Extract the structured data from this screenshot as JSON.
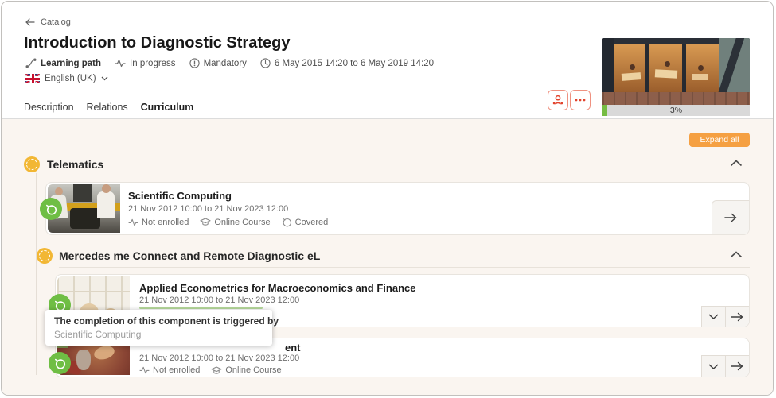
{
  "header": {
    "breadcrumb": {
      "label": "Catalog"
    },
    "title": "Introduction to Diagnostic Strategy",
    "meta": [
      {
        "icon": "learning-path-icon",
        "label": "Learning path"
      },
      {
        "icon": "pulse-icon",
        "label": "In progress"
      },
      {
        "icon": "mandatory-icon",
        "label": "Mandatory"
      },
      {
        "icon": "clock-icon",
        "label": "6 May 2015 14:20 to 6 May 2019 14:20"
      }
    ],
    "language": {
      "icon": "uk-flag-icon",
      "label": "English (UK)"
    },
    "actions": [
      {
        "icon": "member-icon"
      },
      {
        "icon": "more-options-icon"
      }
    ],
    "tabs": [
      {
        "label": "Description",
        "active": false
      },
      {
        "label": "Relations",
        "active": false
      },
      {
        "label": "Curriculum",
        "active": true
      }
    ],
    "cover_image": "office-at-night-aerial-photo",
    "progress": {
      "label": "3%",
      "percent": 3
    }
  },
  "curriculum": {
    "expand_all_label": "Expand all",
    "sections": [
      {
        "title": "Telematics",
        "status_icon": "in-progress-dashed-circle",
        "collapsed": false,
        "items": [
          {
            "title": "Scientific Computing",
            "date_range": "21 Nov 2012 10:00 to 21 Nov 2023 12:00",
            "badge_icon": "covered-green-badge",
            "statuses": [
              {
                "icon": "pulse-icon",
                "label": "Not enrolled"
              },
              {
                "icon": "online-course-icon",
                "label": "Online Course"
              },
              {
                "icon": "covered-icon",
                "label": "Covered"
              }
            ]
          }
        ]
      },
      {
        "title": "Mercedes me Connect and  Remote Diagnostic eL",
        "status_icon": "in-progress-dashed-circle",
        "collapsed": false,
        "items": [
          {
            "title": "Applied Econometrics for Macroeconomics and Finance",
            "date_range": "21 Nov 2012 10:00 to 21 Nov 2023 12:00",
            "badge_icon": "covered-green-badge"
          },
          {
            "title_visible_fragment": "ent",
            "date_range": "21 Nov 2012 10:00 to 21 Nov 2023 12:00",
            "badge_icon": "covered-green-badge",
            "statuses": [
              {
                "icon": "pulse-icon",
                "label": "Not enrolled"
              },
              {
                "icon": "online-course-icon",
                "label": "Online Course"
              }
            ]
          }
        ]
      }
    ]
  },
  "tooltip": {
    "line1": "The completion of this component is triggered by",
    "line2": "Scientific Computing"
  },
  "colors": {
    "accent_orange": "#e84e1c",
    "expand_button_orange": "#f5a042",
    "coral_button_border": "#ef9180",
    "coral_icon": "#e2432c",
    "section_yellow": "#f2b734",
    "badge_green": "#6fbe44",
    "progress_green": "#76bc43",
    "progress_track": "#d9d9d9",
    "content_background": "#faf5f0"
  }
}
